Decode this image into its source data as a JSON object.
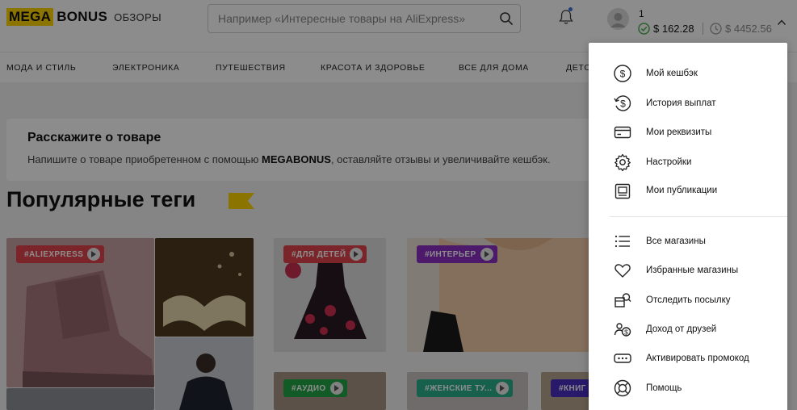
{
  "header": {
    "logo_mega": "MEGA",
    "logo_bonus": "BONUS",
    "logo_section": "ОБЗОРЫ",
    "search_placeholder": "Например «Интересные товары на AliExpress»",
    "user_count": "1",
    "balance_confirmed": "$ 162.28",
    "balance_pending": "$ 4452.56"
  },
  "nav": {
    "items": [
      "МОДА И СТИЛЬ",
      "ЭЛЕКТРОНИКА",
      "ПУТЕШЕСТВИЯ",
      "КРАСОТА И ЗДОРОВЬЕ",
      "ВСЕ ДЛЯ ДОМА",
      "ДЕТСК"
    ]
  },
  "promo": {
    "title": "Расскажите о товаре",
    "text_before": "Напишите о товаре приобретенном с помощью ",
    "text_brand": "MEGABONUS",
    "text_after": ", оставляйте отзывы и увеличивайте кешбэк."
  },
  "tags": {
    "title": "Популярные теги",
    "chips": [
      {
        "label": "#ALIEXPRESS",
        "color": "#e0444f"
      },
      {
        "label": "#ДЛЯ ДЕТЕЙ",
        "color": "#e0444f"
      },
      {
        "label": "#ИНТЕРЬЕР",
        "color": "#8a2fc4"
      },
      {
        "label": "#АУДИО",
        "color": "#22a445"
      },
      {
        "label": "#ЖЕНСКИЕ ТУ...",
        "color": "#28b08a"
      },
      {
        "label": "#КНИГ",
        "color": "#4a2fc4"
      }
    ]
  },
  "menu": {
    "items": [
      {
        "label": "Мой кешбэк",
        "icon": "dollar-circle-icon"
      },
      {
        "label": "История выплат",
        "icon": "dollar-return-icon"
      },
      {
        "label": "Мои реквизиты",
        "icon": "card-icon"
      },
      {
        "label": "Настройки",
        "icon": "gear-icon"
      },
      {
        "label": "Мои публикации",
        "icon": "publication-icon"
      },
      {
        "label": "Все магазины",
        "icon": "list-icon"
      },
      {
        "label": "Избранные магазины",
        "icon": "heart-icon"
      },
      {
        "label": "Отследить посылку",
        "icon": "parcel-icon"
      },
      {
        "label": "Доход от друзей",
        "icon": "friends-income-icon"
      },
      {
        "label": "Активировать промокод",
        "icon": "promo-code-icon"
      },
      {
        "label": "Помощь",
        "icon": "help-icon"
      }
    ]
  },
  "colors": {
    "brand_yellow": "#ffd400",
    "confirmed_green": "#4caf50"
  }
}
